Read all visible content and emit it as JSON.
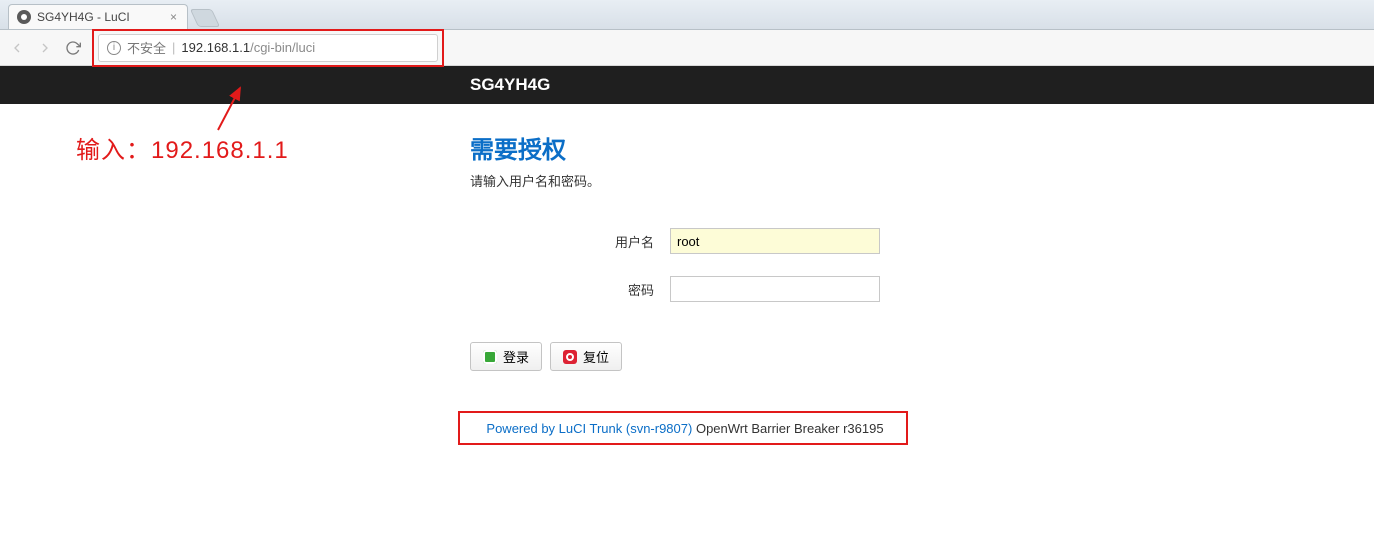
{
  "browser": {
    "tab_title": "SG4YH4G - LuCI",
    "insecure_label": "不安全",
    "url_host": "192.168.1.1",
    "url_path": "/cgi-bin/luci"
  },
  "header": {
    "title": "SG4YH4G"
  },
  "auth": {
    "title": "需要授权",
    "subtitle": "请输入用户名和密码。",
    "username_label": "用户名",
    "username_value": "root",
    "password_label": "密码",
    "password_value": "",
    "login_label": "登录",
    "reset_label": "复位"
  },
  "footer": {
    "link_text": "Powered by LuCI Trunk (svn-r9807)",
    "rest_text": " OpenWrt Barrier Breaker r36195"
  },
  "annotation": {
    "text": "输入：192.168.1.1"
  }
}
